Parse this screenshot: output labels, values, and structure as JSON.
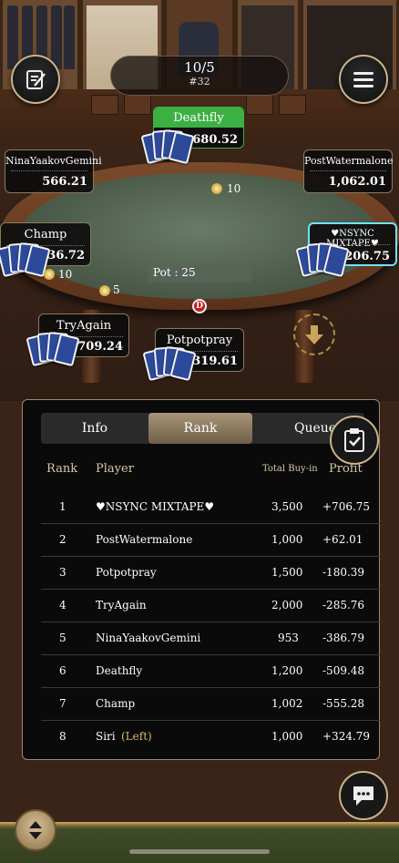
{
  "level": {
    "main": "10/5",
    "sub": "#32"
  },
  "seats": [
    {
      "id": "deathfly",
      "name": "Deathfly",
      "stack": "680.52"
    },
    {
      "id": "nina",
      "name": "NinaYaakovGemini",
      "stack": "566.21"
    },
    {
      "id": "postwater",
      "name": "PostWatermalone",
      "stack": "1,062.01"
    },
    {
      "id": "champ",
      "name": "Champ",
      "stack": "1,436.72"
    },
    {
      "id": "nsync",
      "name": "♥NSYNC MIXTAPE♥",
      "stack": "4,206.75"
    },
    {
      "id": "tryagain",
      "name": "TryAgain",
      "stack": "1,709.24"
    },
    {
      "id": "potpot",
      "name": "Potpotpray",
      "stack": "1,319.61"
    }
  ],
  "bets": {
    "top": "10",
    "left": "10",
    "bottom_left": "5"
  },
  "pot": "Pot : 25",
  "dealer": "D",
  "tabs": [
    {
      "label": "Info"
    },
    {
      "label": "Rank"
    },
    {
      "label": "Queue (0"
    }
  ],
  "rank_table": {
    "headers": {
      "rank": "Rank",
      "player": "Player",
      "buyin": "Total Buy-in",
      "profit": "Profit"
    },
    "rows": [
      {
        "rank": "1",
        "player": "♥NSYNC MIXTAPE♥",
        "buyin": "3,500",
        "profit": "+706.75"
      },
      {
        "rank": "2",
        "player": "PostWatermalone",
        "buyin": "1,000",
        "profit": "+62.01"
      },
      {
        "rank": "3",
        "player": "Potpotpray",
        "buyin": "1,500",
        "profit": "-180.39"
      },
      {
        "rank": "4",
        "player": "TryAgain",
        "buyin": "2,000",
        "profit": "-285.76"
      },
      {
        "rank": "5",
        "player": "NinaYaakovGemini",
        "buyin": "953",
        "profit": "-386.79"
      },
      {
        "rank": "6",
        "player": "Deathfly",
        "buyin": "1,200",
        "profit": "-509.48"
      },
      {
        "rank": "7",
        "player": "Champ",
        "buyin": "1,002",
        "profit": "-555.28"
      },
      {
        "rank": "8",
        "player": "Siri",
        "left": "(Left)",
        "buyin": "1,000",
        "profit": "+324.79"
      }
    ]
  },
  "colors": {
    "accent_gold": "#c9b48a",
    "active_green": "#3cb043",
    "highlight_cyan": "#6fe3ff"
  }
}
